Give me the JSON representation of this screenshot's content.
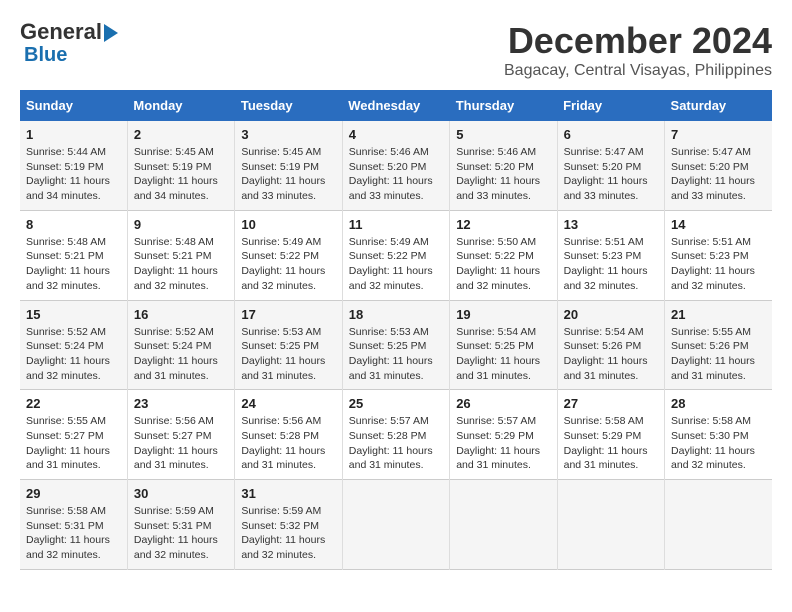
{
  "header": {
    "logo_line1": "General",
    "logo_line2": "Blue",
    "month": "December 2024",
    "location": "Bagacay, Central Visayas, Philippines"
  },
  "columns": [
    "Sunday",
    "Monday",
    "Tuesday",
    "Wednesday",
    "Thursday",
    "Friday",
    "Saturday"
  ],
  "weeks": [
    [
      {
        "day": "1",
        "info": "Sunrise: 5:44 AM\nSunset: 5:19 PM\nDaylight: 11 hours\nand 34 minutes."
      },
      {
        "day": "2",
        "info": "Sunrise: 5:45 AM\nSunset: 5:19 PM\nDaylight: 11 hours\nand 34 minutes."
      },
      {
        "day": "3",
        "info": "Sunrise: 5:45 AM\nSunset: 5:19 PM\nDaylight: 11 hours\nand 33 minutes."
      },
      {
        "day": "4",
        "info": "Sunrise: 5:46 AM\nSunset: 5:20 PM\nDaylight: 11 hours\nand 33 minutes."
      },
      {
        "day": "5",
        "info": "Sunrise: 5:46 AM\nSunset: 5:20 PM\nDaylight: 11 hours\nand 33 minutes."
      },
      {
        "day": "6",
        "info": "Sunrise: 5:47 AM\nSunset: 5:20 PM\nDaylight: 11 hours\nand 33 minutes."
      },
      {
        "day": "7",
        "info": "Sunrise: 5:47 AM\nSunset: 5:20 PM\nDaylight: 11 hours\nand 33 minutes."
      }
    ],
    [
      {
        "day": "8",
        "info": "Sunrise: 5:48 AM\nSunset: 5:21 PM\nDaylight: 11 hours\nand 32 minutes."
      },
      {
        "day": "9",
        "info": "Sunrise: 5:48 AM\nSunset: 5:21 PM\nDaylight: 11 hours\nand 32 minutes."
      },
      {
        "day": "10",
        "info": "Sunrise: 5:49 AM\nSunset: 5:22 PM\nDaylight: 11 hours\nand 32 minutes."
      },
      {
        "day": "11",
        "info": "Sunrise: 5:49 AM\nSunset: 5:22 PM\nDaylight: 11 hours\nand 32 minutes."
      },
      {
        "day": "12",
        "info": "Sunrise: 5:50 AM\nSunset: 5:22 PM\nDaylight: 11 hours\nand 32 minutes."
      },
      {
        "day": "13",
        "info": "Sunrise: 5:51 AM\nSunset: 5:23 PM\nDaylight: 11 hours\nand 32 minutes."
      },
      {
        "day": "14",
        "info": "Sunrise: 5:51 AM\nSunset: 5:23 PM\nDaylight: 11 hours\nand 32 minutes."
      }
    ],
    [
      {
        "day": "15",
        "info": "Sunrise: 5:52 AM\nSunset: 5:24 PM\nDaylight: 11 hours\nand 32 minutes."
      },
      {
        "day": "16",
        "info": "Sunrise: 5:52 AM\nSunset: 5:24 PM\nDaylight: 11 hours\nand 31 minutes."
      },
      {
        "day": "17",
        "info": "Sunrise: 5:53 AM\nSunset: 5:25 PM\nDaylight: 11 hours\nand 31 minutes."
      },
      {
        "day": "18",
        "info": "Sunrise: 5:53 AM\nSunset: 5:25 PM\nDaylight: 11 hours\nand 31 minutes."
      },
      {
        "day": "19",
        "info": "Sunrise: 5:54 AM\nSunset: 5:25 PM\nDaylight: 11 hours\nand 31 minutes."
      },
      {
        "day": "20",
        "info": "Sunrise: 5:54 AM\nSunset: 5:26 PM\nDaylight: 11 hours\nand 31 minutes."
      },
      {
        "day": "21",
        "info": "Sunrise: 5:55 AM\nSunset: 5:26 PM\nDaylight: 11 hours\nand 31 minutes."
      }
    ],
    [
      {
        "day": "22",
        "info": "Sunrise: 5:55 AM\nSunset: 5:27 PM\nDaylight: 11 hours\nand 31 minutes."
      },
      {
        "day": "23",
        "info": "Sunrise: 5:56 AM\nSunset: 5:27 PM\nDaylight: 11 hours\nand 31 minutes."
      },
      {
        "day": "24",
        "info": "Sunrise: 5:56 AM\nSunset: 5:28 PM\nDaylight: 11 hours\nand 31 minutes."
      },
      {
        "day": "25",
        "info": "Sunrise: 5:57 AM\nSunset: 5:28 PM\nDaylight: 11 hours\nand 31 minutes."
      },
      {
        "day": "26",
        "info": "Sunrise: 5:57 AM\nSunset: 5:29 PM\nDaylight: 11 hours\nand 31 minutes."
      },
      {
        "day": "27",
        "info": "Sunrise: 5:58 AM\nSunset: 5:29 PM\nDaylight: 11 hours\nand 31 minutes."
      },
      {
        "day": "28",
        "info": "Sunrise: 5:58 AM\nSunset: 5:30 PM\nDaylight: 11 hours\nand 32 minutes."
      }
    ],
    [
      {
        "day": "29",
        "info": "Sunrise: 5:58 AM\nSunset: 5:31 PM\nDaylight: 11 hours\nand 32 minutes."
      },
      {
        "day": "30",
        "info": "Sunrise: 5:59 AM\nSunset: 5:31 PM\nDaylight: 11 hours\nand 32 minutes."
      },
      {
        "day": "31",
        "info": "Sunrise: 5:59 AM\nSunset: 5:32 PM\nDaylight: 11 hours\nand 32 minutes."
      },
      {
        "day": "",
        "info": ""
      },
      {
        "day": "",
        "info": ""
      },
      {
        "day": "",
        "info": ""
      },
      {
        "day": "",
        "info": ""
      }
    ]
  ]
}
